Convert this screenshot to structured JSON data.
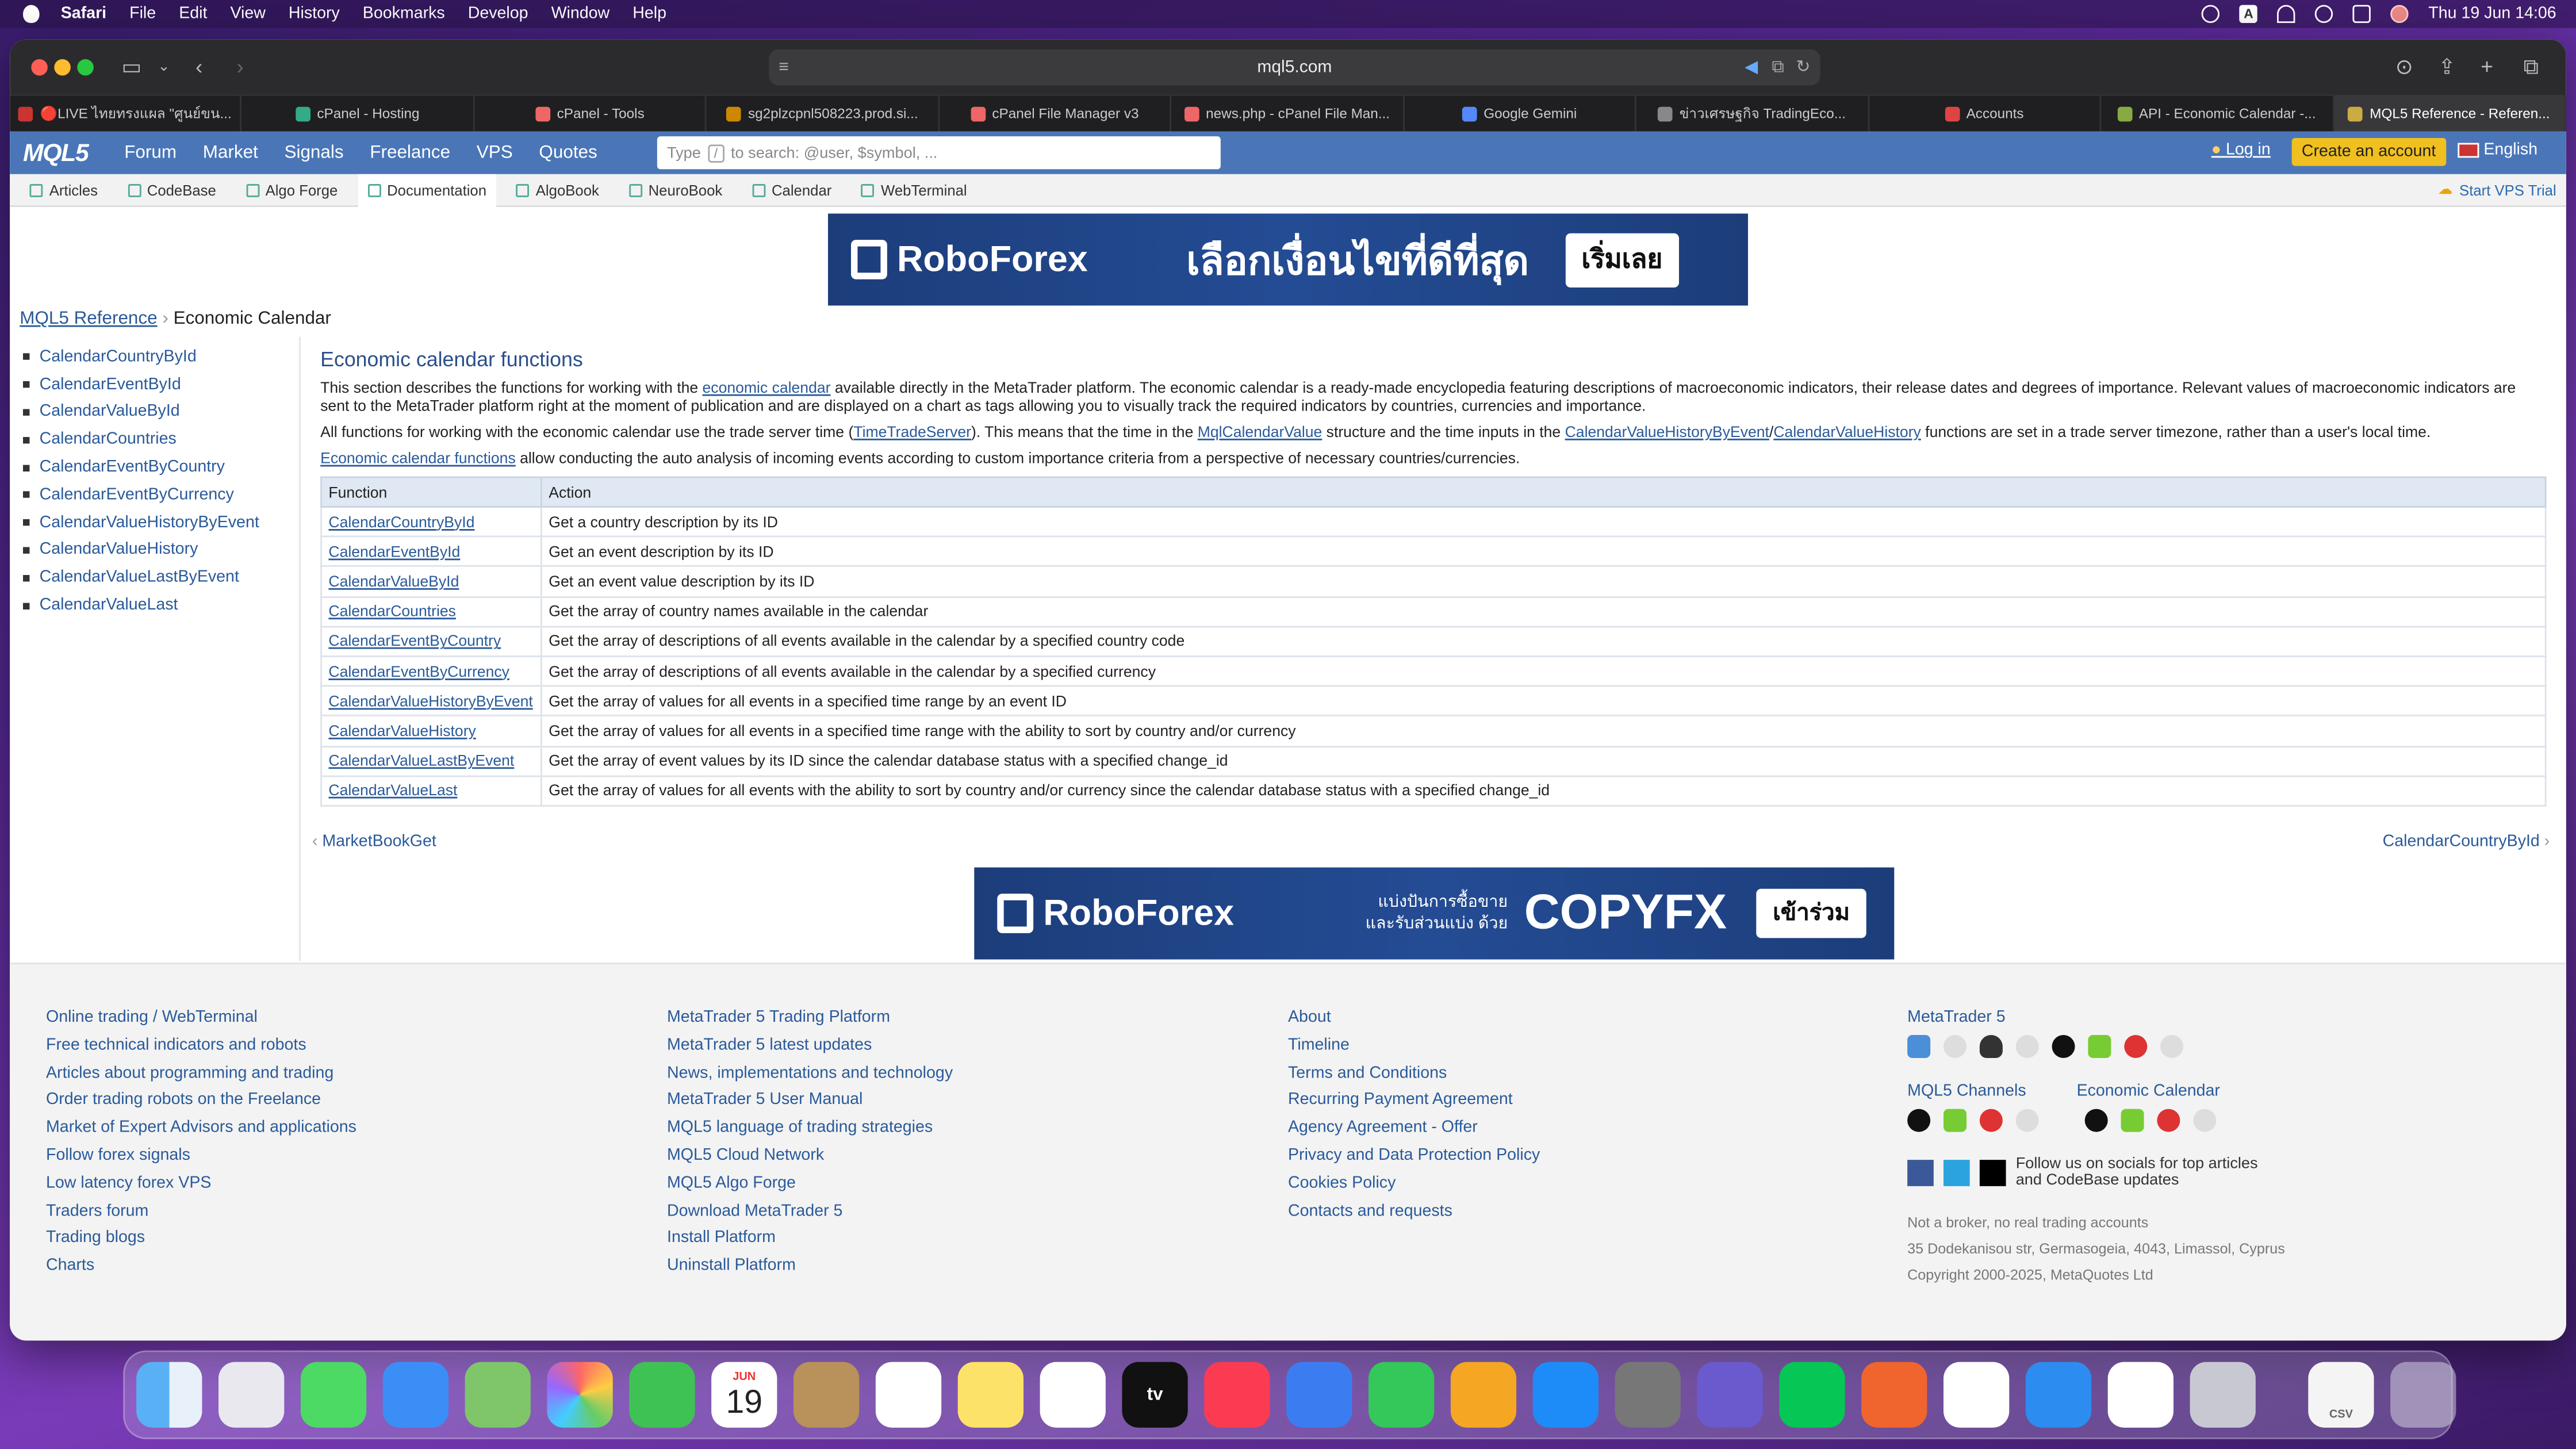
{
  "menubar": {
    "app": "Safari",
    "items": [
      "File",
      "Edit",
      "View",
      "History",
      "Bookmarks",
      "Develop",
      "Window",
      "Help"
    ],
    "clock": "Thu 19 Jun  14:06",
    "input_badge": "A"
  },
  "browser": {
    "url": "mql5.com",
    "tabs": [
      {
        "label": "🔴LIVE ไทยทรงแผล \"ศูนย์ขน...",
        "color": "#c33"
      },
      {
        "label": "cPanel - Hosting",
        "color": "#3a8"
      },
      {
        "label": "cPanel - Tools",
        "color": "#e66"
      },
      {
        "label": "sg2plzcpnl508223.prod.si...",
        "color": "#c80"
      },
      {
        "label": "cPanel File Manager v3",
        "color": "#e66"
      },
      {
        "label": "news.php - cPanel File Man...",
        "color": "#e66"
      },
      {
        "label": "Google Gemini",
        "color": "#58f"
      },
      {
        "label": "ข่าวเศรษฐกิจ TradingEco...",
        "color": "#888"
      },
      {
        "label": "Accounts",
        "color": "#d44"
      },
      {
        "label": "API - Economic Calendar -...",
        "color": "#8a4"
      },
      {
        "label": "MQL5 Reference - Referen...",
        "color": "#ca4"
      }
    ]
  },
  "site": {
    "logo": "MQL5",
    "nav": [
      "Forum",
      "Market",
      "Signals",
      "Freelance",
      "VPS",
      "Quotes"
    ],
    "search": {
      "pre": "Type",
      "key": "/",
      "post": "to search: @user, $symbol, ..."
    },
    "login": "Log in",
    "create": "Create an account",
    "lang": "English",
    "subnav": [
      "Articles",
      "CodeBase",
      "Algo Forge",
      "Documentation",
      "AlgoBook",
      "NeuroBook",
      "Calendar",
      "WebTerminal"
    ],
    "vps_trial": "Start VPS Trial"
  },
  "banner1": {
    "brand": "RoboForex",
    "text": "เลือกเงื่อนไขที่ดีที่สุด",
    "cta": "เริ่มเลย"
  },
  "banner2": {
    "brand": "RoboForex",
    "text_small_1": "แบ่งปันการซื้อขาย",
    "text_small_2": "และรับส่วนแบ่ง ด้วย",
    "text": "COPYFX",
    "cta": "เข้าร่วม"
  },
  "breadcrumb": {
    "root": "MQL5 Reference",
    "current": "Economic Calendar"
  },
  "sidebar": [
    "CalendarCountryById",
    "CalendarEventById",
    "CalendarValueById",
    "CalendarCountries",
    "CalendarEventByCountry",
    "CalendarEventByCurrency",
    "CalendarValueHistoryByEvent",
    "CalendarValueHistory",
    "CalendarValueLastByEvent",
    "CalendarValueLast"
  ],
  "content": {
    "title": "Economic calendar functions",
    "p1a": "This section describes the functions for working with the ",
    "p1link": "economic calendar",
    "p1b": " available directly in the MetaTrader platform. The economic calendar is a ready-made encyclopedia featuring descriptions of macroeconomic indicators, their release dates and degrees of importance. Relevant values of macroeconomic indicators are sent to the MetaTrader platform right at the moment of publication and are displayed on a chart as tags allowing you to visually track the required indicators by countries, currencies and importance.",
    "p2a": "All functions for working with the economic calendar use the trade server time (",
    "p2l1": "TimeTradeServer",
    "p2b": "). This means that the time in the ",
    "p2l2": "MqlCalendarValue",
    "p2c": " structure and the time inputs in the ",
    "p2l3": "CalendarValueHistoryByEvent",
    "p2d": "/",
    "p2l4": "CalendarValueHistory",
    "p2e": " functions are set in a trade server timezone, rather than a user's local time.",
    "p3link": "Economic calendar functions",
    "p3": " allow conducting the auto analysis of incoming events according to custom importance criteria from a perspective of necessary countries/currencies.",
    "th_function": "Function",
    "th_action": "Action",
    "rows": [
      [
        "CalendarCountryById",
        "Get a country description by its ID"
      ],
      [
        "CalendarEventById",
        "Get an event description by its ID"
      ],
      [
        "CalendarValueById",
        "Get an event value description by its ID"
      ],
      [
        "CalendarCountries",
        "Get the array of country names available in the calendar"
      ],
      [
        "CalendarEventByCountry",
        "Get the array of descriptions of all events available in the calendar by a specified country code"
      ],
      [
        "CalendarEventByCurrency",
        "Get the array of descriptions of all events available in the calendar by a specified currency"
      ],
      [
        "CalendarValueHistoryByEvent",
        "Get the array of values for all events in a specified time range by an event ID"
      ],
      [
        "CalendarValueHistory",
        "Get the array of values for all events in a specified time range with the ability to sort by country and/or currency"
      ],
      [
        "CalendarValueLastByEvent",
        "Get the array of event values by its ID since the calendar database status with a specified change_id"
      ],
      [
        "CalendarValueLast",
        "Get the array of values for all events with the ability to sort by country and/or currency since the calendar database status with a specified change_id"
      ]
    ],
    "prev": "MarketBookGet",
    "next": "CalendarCountryById"
  },
  "footer": {
    "col1": [
      "Online trading / WebTerminal",
      "Free technical indicators and robots",
      "Articles about programming and trading",
      "Order trading robots on the Freelance",
      "Market of Expert Advisors and applications",
      "Follow forex signals",
      "Low latency forex VPS",
      "Traders forum",
      "Trading blogs",
      "Charts"
    ],
    "col2": [
      "MetaTrader 5 Trading Platform",
      "MetaTrader 5 latest updates",
      "News, implementations and technology",
      "MetaTrader 5 User Manual",
      "MQL5 language of trading strategies",
      "MQL5 Cloud Network",
      "MQL5 Algo Forge",
      "Download MetaTrader 5",
      "Install Platform",
      "Uninstall Platform"
    ],
    "col3": [
      "About",
      "Timeline",
      "Terms and Conditions",
      "Recurring Payment Agreement",
      "Agency Agreement - Offer",
      "Privacy and Data Protection Policy",
      "Cookies Policy",
      "Contacts and requests"
    ],
    "mt5": "MetaTrader 5",
    "channels": "MQL5 Channels",
    "calendar": "Economic Calendar",
    "social": "Follow us on socials for top articles and CodeBase updates",
    "broker": "Not a broker, no real trading accounts",
    "address": "35 Dodekanisou str, Germasogeia, 4043, Limassol, Cyprus",
    "copyright": "Copyright 2000-2025, MetaQuotes Ltd"
  },
  "dock": {
    "calendar_month": "JUN",
    "calendar_day": "19",
    "tv": "tv",
    "file_label": "CSV"
  }
}
